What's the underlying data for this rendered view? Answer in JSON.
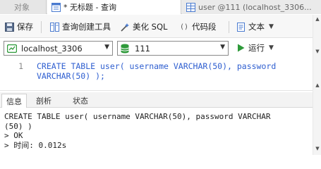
{
  "tabs": [
    {
      "label": "对象",
      "icon": "objects-icon"
    },
    {
      "label": "* 无标题 - 查询",
      "icon": "query-icon"
    },
    {
      "label": "user @111 (localhost_3306...",
      "icon": "table-icon"
    }
  ],
  "toolbar": {
    "save": "保存",
    "query_builder": "查询创建工具",
    "beautify": "美化 SQL",
    "code_snippet": "代码段",
    "text": "文本"
  },
  "connection": {
    "selected": "localhost_3306",
    "database": "111",
    "run": "运行"
  },
  "editor": {
    "line_number": "1",
    "line1": "CREATE TABLE user( username VARCHAR(50), password",
    "line2": "VARCHAR(50) );"
  },
  "result_tabs": [
    "信息",
    "剖析",
    "状态"
  ],
  "output": {
    "line1": "CREATE TABLE user( username VARCHAR(50), password VARCHAR",
    "line2": "(50) )",
    "line3": "> OK",
    "line4": "> 时间: 0.012s"
  },
  "colors": {
    "accent_green": "#2e9a3a",
    "code_blue": "#2f5fd0"
  }
}
